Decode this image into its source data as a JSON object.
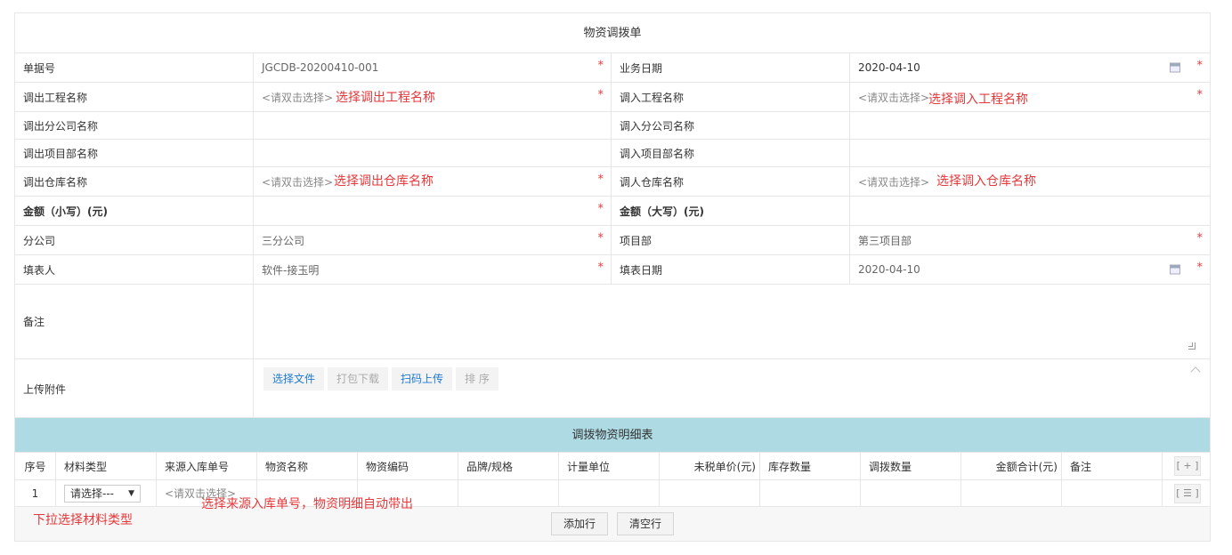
{
  "form": {
    "title": "物资调拨单",
    "rows": [
      {
        "l1": "单据号",
        "v1": "JGCDB-20200410-001",
        "l2": "业务日期",
        "v2": "2020-04-10"
      },
      {
        "l1": "调出工程名称",
        "v1": "<请双击选择>",
        "l2": "调入工程名称",
        "v2": "<请双击选择>"
      },
      {
        "l1": "调出分公司名称",
        "v1": "",
        "l2": "调入分公司名称",
        "v2": ""
      },
      {
        "l1": "调出项目部名称",
        "v1": "",
        "l2": "调入项目部名称",
        "v2": ""
      },
      {
        "l1": "调出仓库名称",
        "v1": "<请双击选择>",
        "l2": "调人仓库名称",
        "v2": "<请双击选择>"
      },
      {
        "l1": "金额（小写）(元)",
        "v1": "",
        "l2": "金额（大写）(元)",
        "v2": ""
      },
      {
        "l1": "分公司",
        "v1": "三分公司",
        "l2": "项目部",
        "v2": "第三项目部"
      },
      {
        "l1": "填表人",
        "v1": "软件-接玉明",
        "l2": "填表日期",
        "v2": "2020-04-10"
      }
    ],
    "required_mark": "*",
    "remark_label": "备注",
    "attach_label": "上传附件",
    "attach_buttons": [
      "选择文件",
      "打包下载",
      "扫码上传",
      "排 序"
    ]
  },
  "annotations": {
    "out_project": "选择调出工程名称",
    "in_project": "选择调入工程名称",
    "out_warehouse": "选择调出仓库名称",
    "in_warehouse": "选择调入仓库名称",
    "material_type": "下拉选择材料类型",
    "source_no": "选择来源入库单号，物资明细自动带出"
  },
  "detail": {
    "title": "调拨物资明细表",
    "columns": [
      "序号",
      "材料类型",
      "来源入库单号",
      "物资名称",
      "物资编码",
      "品牌/规格",
      "计量单位",
      "未税单价(元)",
      "库存数量",
      "调拨数量",
      "金额合计(元)",
      "备注"
    ],
    "add_icon_label": "[ + ]",
    "row": {
      "index": "1",
      "material_type": "请选择---",
      "source_no": "<请双击选择>",
      "menu_icon_label": "[ ☰ ]"
    },
    "add_row": "添加行",
    "clear_rows": "清空行"
  },
  "colors": {
    "required": "#e4393c",
    "detail_header_bg": "#aedbe3",
    "link_blue": "#1e7ad0"
  }
}
